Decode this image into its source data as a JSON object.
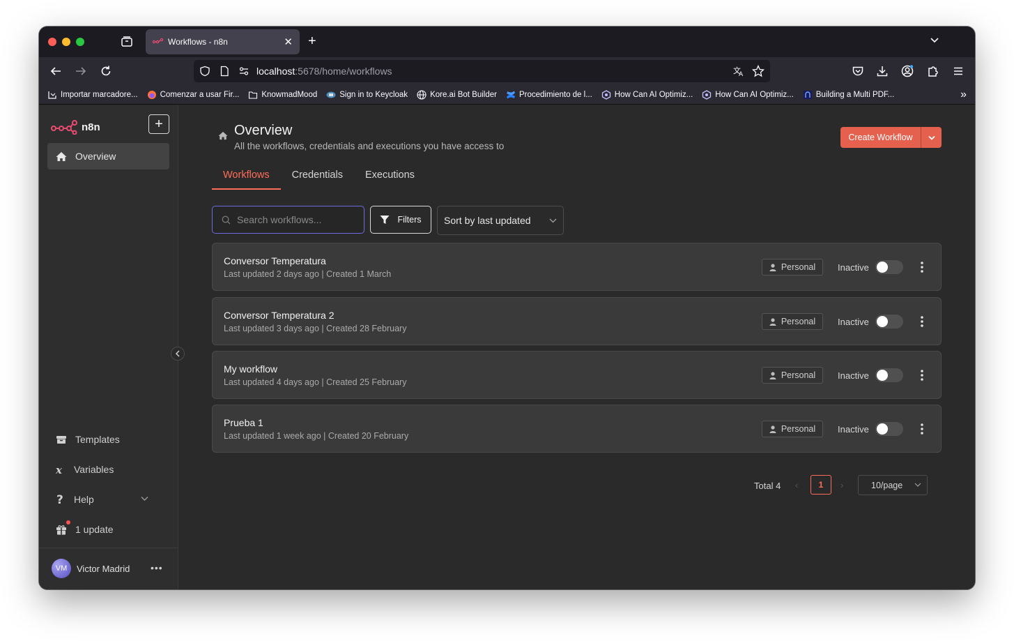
{
  "browser": {
    "tab_title": "Workflows - n8n",
    "url_host": "localhost",
    "url_path": ":5678/home/workflows",
    "bookmarks": [
      {
        "label": "Importar marcadore..."
      },
      {
        "label": "Comenzar a usar Fir..."
      },
      {
        "label": "KnowmadMood"
      },
      {
        "label": "Sign in to Keycloak"
      },
      {
        "label": "Kore.ai Bot Builder"
      },
      {
        "label": "Procedimiento de l..."
      },
      {
        "label": "How Can AI Optimiz..."
      },
      {
        "label": "How Can AI Optimiz..."
      },
      {
        "label": "Building a Multi PDF..."
      }
    ]
  },
  "sidebar": {
    "logo_text": "n8n",
    "overview_label": "Overview",
    "templates_label": "Templates",
    "variables_label": "Variables",
    "help_label": "Help",
    "update_label": "1 update",
    "user_initials": "VM",
    "user_name": "Victor Madrid"
  },
  "header": {
    "title": "Overview",
    "subtitle": "All the workflows, credentials and executions you have access to",
    "create_button": "Create Workflow"
  },
  "tabs": [
    "Workflows",
    "Credentials",
    "Executions"
  ],
  "toolbar": {
    "search_placeholder": "Search workflows...",
    "filters_label": "Filters",
    "sort_label": "Sort by last updated"
  },
  "workflows": [
    {
      "name": "Conversor Temperatura",
      "meta": "Last updated 2 days ago | Created 1 March",
      "badge": "Personal",
      "status": "Inactive"
    },
    {
      "name": "Conversor Temperatura 2",
      "meta": "Last updated 3 days ago | Created 28 February",
      "badge": "Personal",
      "status": "Inactive"
    },
    {
      "name": "My workflow",
      "meta": "Last updated 4 days ago | Created 25 February",
      "badge": "Personal",
      "status": "Inactive"
    },
    {
      "name": "Prueba 1",
      "meta": "Last updated 1 week ago | Created 20 February",
      "badge": "Personal",
      "status": "Inactive"
    }
  ],
  "pagination": {
    "total_label": "Total 4",
    "current_page": "1",
    "page_size": "10/page"
  },
  "colors": {
    "accent": "#ff6d5a",
    "create_button_bg": "#e5604d",
    "search_focus": "#6f6be0"
  }
}
